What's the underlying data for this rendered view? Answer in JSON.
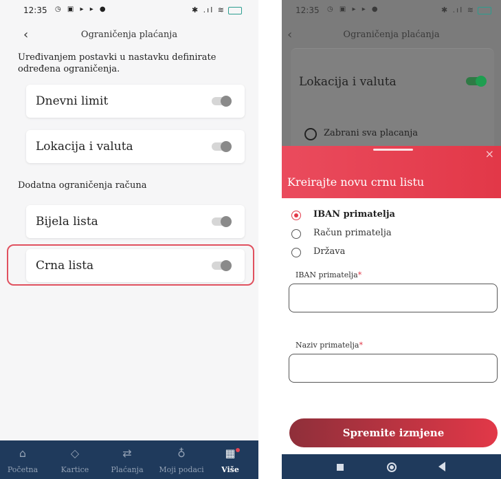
{
  "status_bar": {
    "time": "12:35",
    "left_icons": "◷ ▣ ▸ ▸ ●",
    "right_icons": "✱ .ıl ≋"
  },
  "left_screen": {
    "title": "Ograničenja plaćanja",
    "back": "‹",
    "description": "Uređivanjem postavki u nastavku definirate određena ograničenja.",
    "items": [
      {
        "label": "Dnevni limit",
        "enabled": false
      },
      {
        "label": "Lokacija i valuta",
        "enabled": false
      }
    ],
    "section_title": "Dodatna ograničenja računa",
    "account_items": [
      {
        "label": "Bijela lista",
        "enabled": false
      },
      {
        "label": "Crna lista",
        "enabled": false,
        "highlighted": true
      }
    ],
    "tabs": [
      {
        "label": "Početna",
        "icon": "home-icon",
        "glyph": "⌂",
        "active": false
      },
      {
        "label": "Kartice",
        "icon": "card-icon",
        "glyph": "◇",
        "active": false
      },
      {
        "label": "Plaćanja",
        "icon": "transfer-icon",
        "glyph": "⇄",
        "active": false
      },
      {
        "label": "Moji podaci",
        "icon": "user-icon",
        "glyph": "♁",
        "active": false
      },
      {
        "label": "Više",
        "icon": "grid-icon",
        "glyph": "▦",
        "active": true
      }
    ]
  },
  "right_screen": {
    "title": "Ograničenja plaćanja",
    "back": "‹",
    "background_card": {
      "label": "Lokacija i valuta",
      "enabled": true,
      "option": "Zabrani sva placanja"
    },
    "sheet": {
      "title": "Kreirajte novu crnu listu",
      "close": "×",
      "options": [
        {
          "label": "IBAN primatelja",
          "selected": true
        },
        {
          "label": "Račun primatelja",
          "selected": false
        },
        {
          "label": "Država",
          "selected": false
        }
      ],
      "fields": [
        {
          "label": "IBAN primatelja",
          "required_mark": "*",
          "value": ""
        },
        {
          "label": "Naziv primatelja",
          "required_mark": "*",
          "value": ""
        }
      ],
      "save_label": "Spremite izmjene"
    }
  },
  "colors": {
    "accent": "#E23848",
    "navy": "#1F3A5C",
    "toggle_on": "#1E9E50"
  }
}
